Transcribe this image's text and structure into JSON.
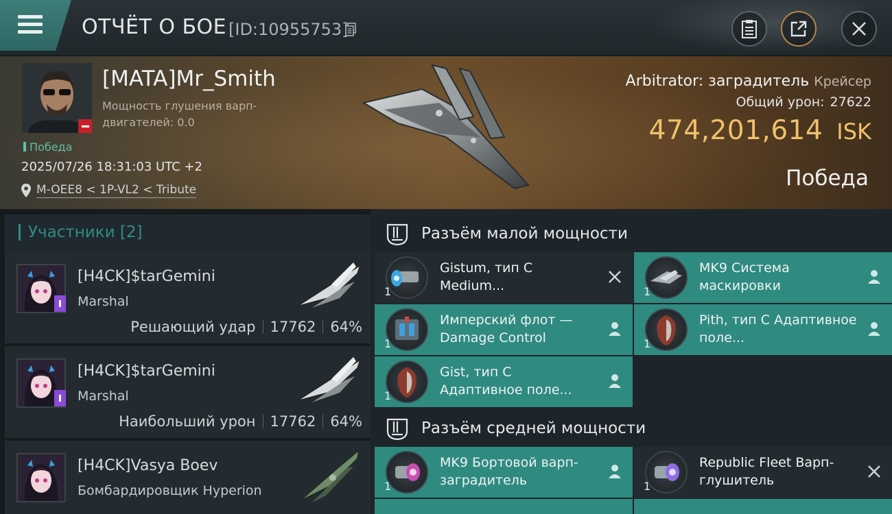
{
  "header": {
    "title": "ОТЧЁТ О БОЕ",
    "report_id": "[ID:10955753]"
  },
  "victim": {
    "name": "[MATA]Mr_Smith",
    "warp_scramble_label": "Мощность глушения варп-двигателей: 0.0",
    "result": "Победа",
    "datetime": "2025/07/26 18:31:03 UTC +2",
    "location": "M-OEE8 < 1P-VL2 < Tribute",
    "ship_name": "Arbitrator: заградитель",
    "ship_class": "Крейсер",
    "total_damage_label": "Общий урон:",
    "total_damage": "27622",
    "isk_value": "474,201,614",
    "isk_unit": "ISK",
    "outcome": "Победа"
  },
  "participants": {
    "title": "Участники [2]",
    "rows": [
      {
        "name": "[H4CK]$tarGemini",
        "ship": "Marshal",
        "role": "Решающий удар",
        "damage": "17762",
        "percent": "64%"
      },
      {
        "name": "[H4CK]$tarGemini",
        "ship": "Marshal",
        "role": "Наибольший урон",
        "damage": "17762",
        "percent": "64%"
      },
      {
        "name": "[H4CK]Vasya Boev",
        "ship": "Бомбардировщик Hyperion",
        "role": "",
        "damage": "",
        "percent": ""
      }
    ]
  },
  "slots": {
    "low": {
      "title": "Разъём малой мощности",
      "modules": [
        {
          "name": "Gistum, тип C Medium...",
          "qty": "1",
          "state": "destroyed",
          "icon": "shield-extender-icon"
        },
        {
          "name": "MK9 Система маскировки",
          "qty": "1",
          "state": "dropped",
          "icon": "cloak-icon"
        },
        {
          "name": "Имперский флот — Damage Control",
          "qty": "1",
          "state": "dropped",
          "icon": "damage-control-icon"
        },
        {
          "name": "Pith, тип C Адаптивное поле...",
          "qty": "1",
          "state": "dropped",
          "icon": "adaptive-field-icon"
        },
        {
          "name": "Gist, тип C Адаптивное поле...",
          "qty": "1",
          "state": "dropped",
          "icon": "adaptive-field-icon"
        }
      ]
    },
    "mid": {
      "title": "Разъём средней мощности",
      "modules": [
        {
          "name": "MK9 Бортовой варп-заградитель",
          "qty": "1",
          "state": "dropped",
          "icon": "warp-disruptor-icon"
        },
        {
          "name": "Republic Fleet Варп-глушитель",
          "qty": "1",
          "state": "destroyed",
          "icon": "warp-scrambler-icon"
        }
      ]
    }
  },
  "colors": {
    "accent_teal": "#2f8a80",
    "isk_gold": "#f0c16c",
    "result_green": "#5fbfa6",
    "danger_red": "#c8202a"
  }
}
